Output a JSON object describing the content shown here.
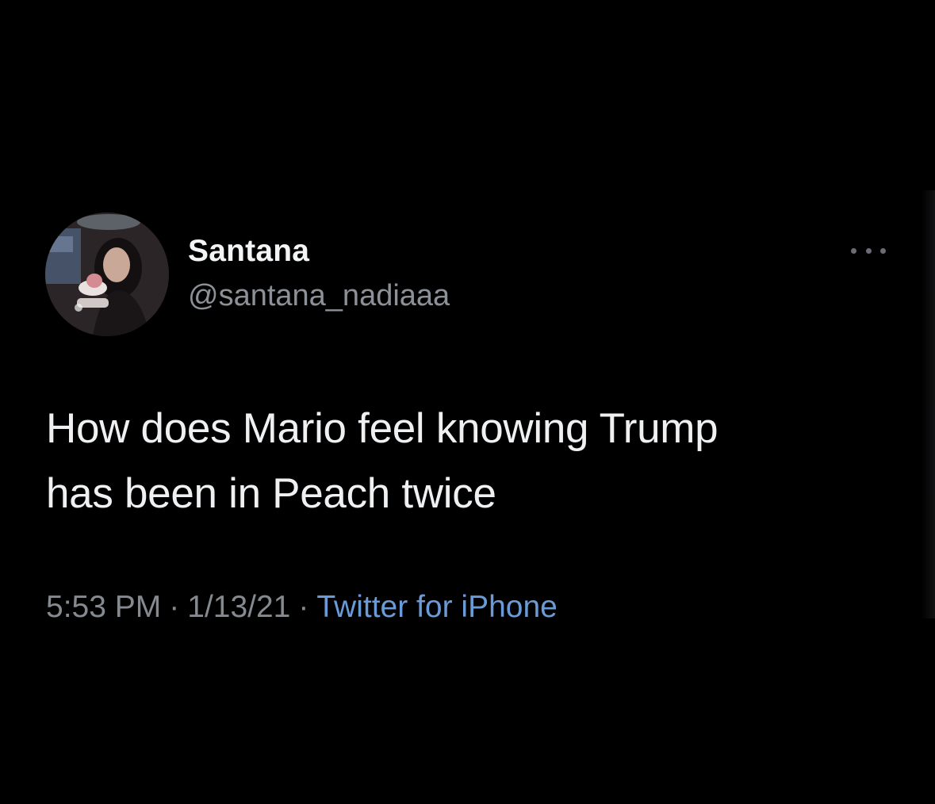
{
  "tweet": {
    "author": {
      "display_name": "Santana",
      "handle": "@santana_nadiaaa",
      "avatar_icon": "profile-photo"
    },
    "more_icon": "more-horizontal-icon",
    "text_lines": [
      "How does Mario feel knowing Trump",
      "has been in Peach twice"
    ],
    "meta": {
      "time": "5:53 PM",
      "separator": "·",
      "date": "1/13/21",
      "source": "Twitter for iPhone"
    }
  },
  "colors": {
    "background": "#000000",
    "text_primary": "#f1f2f3",
    "text_secondary": "#858a91",
    "link": "#6a9bd6"
  }
}
